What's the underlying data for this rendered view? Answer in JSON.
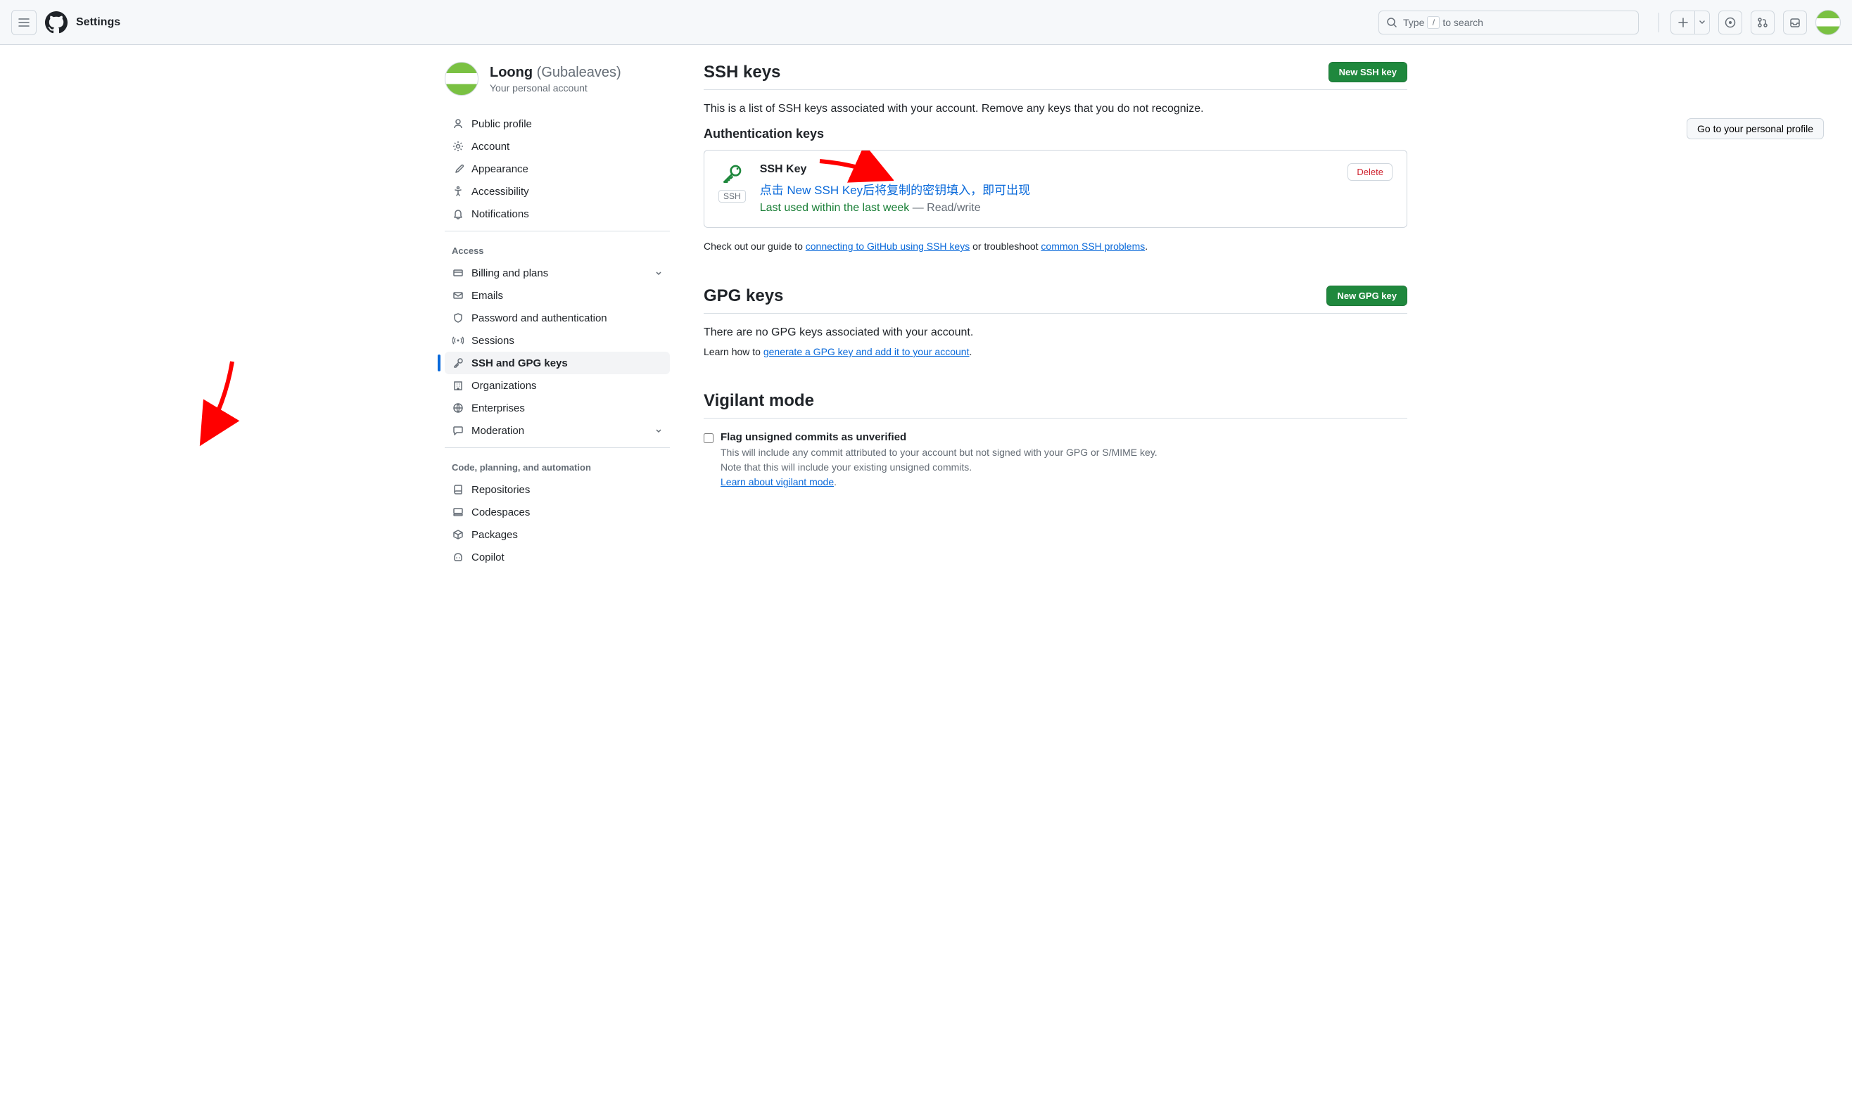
{
  "topbar": {
    "title": "Settings",
    "search_prefix": "Type",
    "search_key": "/",
    "search_suffix": "to search"
  },
  "profile": {
    "name": "Loong",
    "handle": "(Gubaleaves)",
    "sub": "Your personal account",
    "go_to_profile": "Go to your personal profile"
  },
  "nav": {
    "items_top": [
      {
        "label": "Public profile"
      },
      {
        "label": "Account"
      },
      {
        "label": "Appearance"
      },
      {
        "label": "Accessibility"
      },
      {
        "label": "Notifications"
      }
    ],
    "section_access": "Access",
    "items_access": [
      {
        "label": "Billing and plans",
        "chevron": true
      },
      {
        "label": "Emails"
      },
      {
        "label": "Password and authentication"
      },
      {
        "label": "Sessions"
      },
      {
        "label": "SSH and GPG keys",
        "active": true
      },
      {
        "label": "Organizations"
      },
      {
        "label": "Enterprises"
      },
      {
        "label": "Moderation",
        "chevron": true
      }
    ],
    "section_code": "Code, planning, and automation",
    "items_code": [
      {
        "label": "Repositories"
      },
      {
        "label": "Codespaces"
      },
      {
        "label": "Packages"
      },
      {
        "label": "Copilot"
      }
    ]
  },
  "ssh": {
    "title": "SSH keys",
    "new_btn": "New SSH key",
    "desc": "This is a list of SSH keys associated with your account. Remove any keys that you do not recognize.",
    "auth_title": "Authentication keys",
    "key": {
      "name": "SSH Key",
      "tag": "SSH",
      "note": "点击 New SSH Key后将复制的密钥填入，即可出现",
      "used": "Last used within the last week",
      "rw": " — Read/write",
      "delete": "Delete"
    },
    "guide_prefix": "Check out our guide to ",
    "guide_link1": "connecting to GitHub using SSH keys",
    "guide_mid": " or troubleshoot ",
    "guide_link2": "common SSH problems",
    "guide_suffix": "."
  },
  "gpg": {
    "title": "GPG keys",
    "new_btn": "New GPG key",
    "empty": "There are no GPG keys associated with your account.",
    "learn_prefix": "Learn how to ",
    "learn_link": "generate a GPG key and add it to your account",
    "learn_suffix": "."
  },
  "vigilant": {
    "title": "Vigilant mode",
    "flag_label": "Flag unsigned commits as unverified",
    "flag_desc1": "This will include any commit attributed to your account but not signed with your GPG or S/MIME key.",
    "flag_desc2": "Note that this will include your existing unsigned commits.",
    "learn_link": "Learn about vigilant mode"
  }
}
